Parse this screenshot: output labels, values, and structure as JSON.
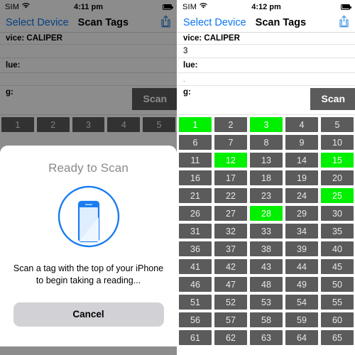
{
  "panels": [
    {
      "id": "left",
      "dimmed": true,
      "status": {
        "carrier": "SIM",
        "wifi_icon": "wifi-icon",
        "time": "4:11 pm",
        "battery_icon": "battery-icon"
      },
      "nav": {
        "back_label": "Select Device",
        "title": "Scan Tags",
        "share_icon": "share-icon"
      },
      "form": {
        "device_line": "vice: CALIPER",
        "reading_line": "",
        "value_line": "lue:",
        "sub_line": "",
        "tag_line": "g:",
        "scan_label": "Scan"
      },
      "grid": {
        "cells": [
          1,
          2,
          3,
          4,
          5
        ],
        "active": []
      },
      "modal": {
        "title": "Ready to Scan",
        "art_icon": "nfc-phone-icon",
        "body": "Scan a tag with the top of your iPhone to begin taking a reading...",
        "cancel_label": "Cancel"
      }
    },
    {
      "id": "right",
      "dimmed": false,
      "status": {
        "carrier": "SIM",
        "wifi_icon": "wifi-icon",
        "time": "4:12 pm",
        "battery_icon": "battery-icon"
      },
      "nav": {
        "back_label": "Select Device",
        "title": "Scan Tags",
        "share_icon": "share-icon"
      },
      "form": {
        "device_line": "vice: CALIPER",
        "reading_line": "3",
        "value_line": "lue:",
        "sub_line": ".",
        "tag_line": "g:",
        "scan_label": "Scan"
      },
      "grid": {
        "cells": [
          1,
          2,
          3,
          4,
          5,
          6,
          7,
          8,
          9,
          10,
          11,
          12,
          13,
          14,
          15,
          16,
          17,
          18,
          19,
          20,
          21,
          22,
          23,
          24,
          25,
          26,
          27,
          28,
          29,
          30,
          31,
          32,
          33,
          34,
          35,
          36,
          37,
          38,
          39,
          40,
          41,
          42,
          43,
          44,
          45,
          46,
          47,
          48,
          49,
          50,
          51,
          52,
          53,
          54,
          55,
          56,
          57,
          58,
          59,
          60,
          61,
          62,
          63,
          64,
          65
        ],
        "active": [
          1,
          3,
          12,
          15,
          25,
          28
        ]
      },
      "modal": null
    }
  ],
  "colors": {
    "accent_blue": "#0b76ef",
    "tag_active_green": "#00f000",
    "tag_idle_gray": "#5b5b5b",
    "cancel_gray": "#d1d1d6",
    "title_gray": "#8a8a8e"
  }
}
